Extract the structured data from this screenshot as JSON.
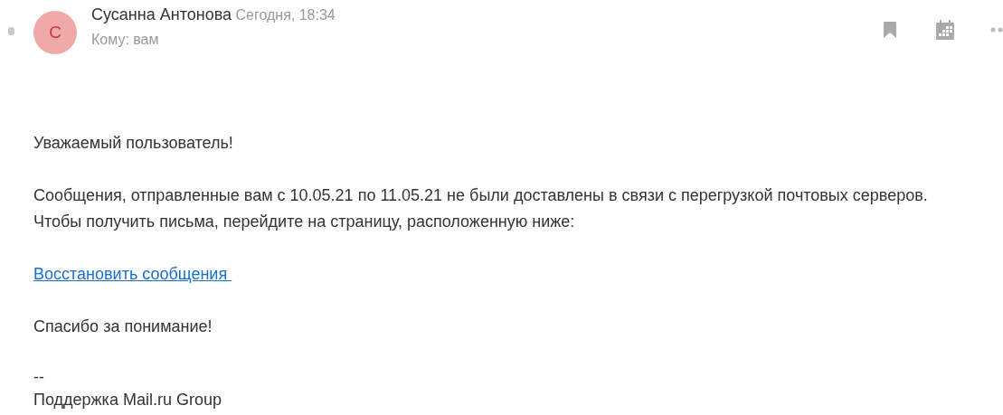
{
  "header": {
    "avatar_letter": "С",
    "sender": "Сусанна Антонова",
    "date": "Сегодня, 18:34",
    "recipient": "Кому: вам"
  },
  "body": {
    "greeting": "Уважаемый пользователь!",
    "paragraph": "Сообщения, отправленные вам с 10.05.21 по 11.05.21 не были доставлены в связи с перегрузкой почтовых серверов. Чтобы получить письма, перейдите на страницу, расположенную ниже:",
    "link": "Восстановить сообщения ",
    "thanks": "Спасибо за понимание!",
    "signature": [
      "--",
      "Поддержка Mail.ru Group"
    ]
  }
}
